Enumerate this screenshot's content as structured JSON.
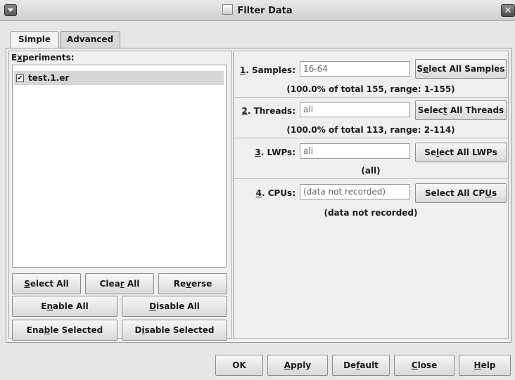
{
  "window": {
    "title": "Filter Data"
  },
  "tabs": [
    {
      "label": "Simple"
    },
    {
      "label": "Advanced"
    }
  ],
  "experiments": {
    "heading_pre": "E",
    "heading_ul": "x",
    "heading_post": "periments:",
    "items": [
      {
        "label": "test.1.er",
        "checked": "✔"
      }
    ]
  },
  "list_buttons": {
    "select_all": {
      "pre": "",
      "ul": "S",
      "post": "elect All"
    },
    "clear_all": {
      "pre": "Clea",
      "ul": "r",
      "post": " All"
    },
    "reverse": {
      "pre": "Re",
      "ul": "v",
      "post": "erse"
    },
    "enable_all": {
      "pre": "E",
      "ul": "n",
      "post": "able All"
    },
    "disable_all": {
      "pre": "",
      "ul": "D",
      "post": "isable All"
    },
    "enable_selected": {
      "pre": "Ena",
      "ul": "b",
      "post": "le Selected"
    },
    "disable_selected": {
      "pre": "D",
      "ul": "i",
      "post": "sable Selected"
    }
  },
  "filters": [
    {
      "num": "1",
      "label": ". Samples:",
      "value": "16-64",
      "button_pre": "S",
      "button_ul": "e",
      "button_post": "lect All Samples",
      "summary": "(100.0% of total 155, range: 1-155)"
    },
    {
      "num": "2",
      "label": ". Threads:",
      "value": "all",
      "button_pre": "Selec",
      "button_ul": "t",
      "button_post": " All Threads",
      "summary": "(100.0% of total 113, range: 2-114)"
    },
    {
      "num": "3",
      "label": ". LWPs:",
      "value": "all",
      "button_pre": "Se",
      "button_ul": "l",
      "button_post": "ect All LWPs",
      "summary": "(all)"
    },
    {
      "num": "4",
      "label": ". CPUs:",
      "value": "(data not recorded)",
      "button_pre": "Select All CP",
      "button_ul": "U",
      "button_post": "s",
      "summary": "(data not recorded)"
    }
  ],
  "dialog_buttons": {
    "ok": {
      "pre": "OK",
      "ul": "",
      "post": ""
    },
    "apply": {
      "pre": "",
      "ul": "A",
      "post": "pply"
    },
    "default": {
      "pre": "De",
      "ul": "f",
      "post": "ault"
    },
    "close": {
      "pre": "",
      "ul": "C",
      "post": "lose"
    },
    "help": {
      "pre": "",
      "ul": "H",
      "post": "elp"
    }
  },
  "icons": {
    "window_menu": "window-menu-icon",
    "close": "close-icon",
    "title": "filter-icon",
    "check": "checkbox-checked-icon"
  }
}
